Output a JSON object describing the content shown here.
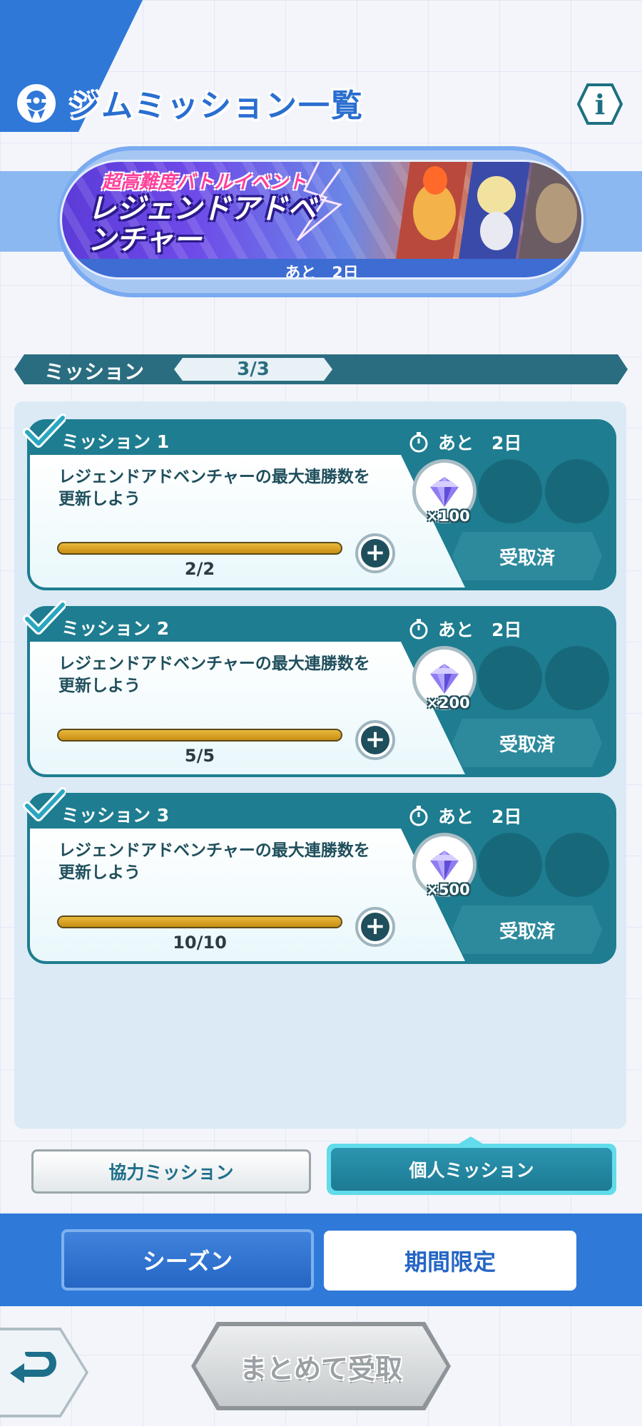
{
  "header": {
    "title": "ジムミッション一覧",
    "medal_icon": "medal-icon",
    "info_label": "i"
  },
  "banner": {
    "subtitle": "超高難度バトルイベント",
    "title": "レジェンドアドベンチャー",
    "remaining": "あと　2日"
  },
  "mission_bar": {
    "label": "ミッション",
    "count": "3/3"
  },
  "missions": [
    {
      "title": "ミッション 1",
      "description": "レジェンドアドベンチャーの最大連勝数を更新しよう",
      "progress_text": "2/2",
      "progress": 1.0,
      "timer": "あと　2日",
      "reward_qty": "×100",
      "claim_label": "受取済",
      "completed": true
    },
    {
      "title": "ミッション 2",
      "description": "レジェンドアドベンチャーの最大連勝数を更新しよう",
      "progress_text": "5/5",
      "progress": 1.0,
      "timer": "あと　2日",
      "reward_qty": "×200",
      "claim_label": "受取済",
      "completed": true
    },
    {
      "title": "ミッション 3",
      "description": "レジェンドアドベンチャーの最大連勝数を更新しよう",
      "progress_text": "10/10",
      "progress": 1.0,
      "timer": "あと　2日",
      "reward_qty": "×500",
      "claim_label": "受取済",
      "completed": true
    }
  ],
  "mission_type_tabs": {
    "coop": "協力ミッション",
    "personal": "個人ミッション",
    "selected": "personal"
  },
  "period_tabs": {
    "season": "シーズン",
    "limited": "期間限定"
  },
  "footer": {
    "bulk_claim": "まとめて受取",
    "back_icon": "back-arrow-icon"
  },
  "colors": {
    "header_blue": "#2f78d8",
    "card_teal": "#1e7d90",
    "progress_gold": "#d9a52a",
    "tab_blue": "#2f79d9"
  }
}
